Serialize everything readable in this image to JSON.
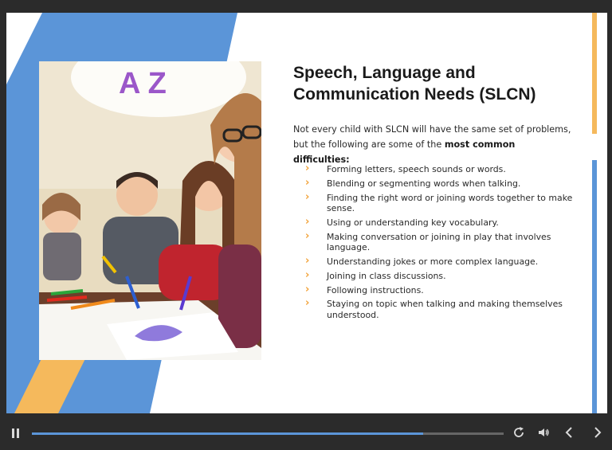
{
  "slide": {
    "title_line1": "Speech, Language and",
    "title_line2": "Communication Needs (SLCN)",
    "intro_text": "Not every child with SLCN will have the same set of problems, but the following are some of the ",
    "intro_bold": "most common difficulties:",
    "bullets": [
      "Forming letters, speech sounds or words.",
      "Blending or segmenting words when talking.",
      "Finding the right word or joining words together to make sense.",
      "Using or understanding key vocabulary.",
      "Making conversation or joining in play that involves language.",
      "Understanding jokes or more complex language.",
      "Joining in class discussions.",
      "Following instructions.",
      "Staying on topic when talking and making themselves understood."
    ],
    "photo_letters": "A Z",
    "colors": {
      "accent_blue": "#5b95d8",
      "accent_orange": "#f5b95c",
      "chevron": "#f2a33a"
    }
  },
  "player": {
    "progress": 0.83,
    "icons": [
      "pause-icon",
      "replay-icon",
      "volume-icon",
      "chevron-left-icon",
      "chevron-right-icon"
    ]
  }
}
